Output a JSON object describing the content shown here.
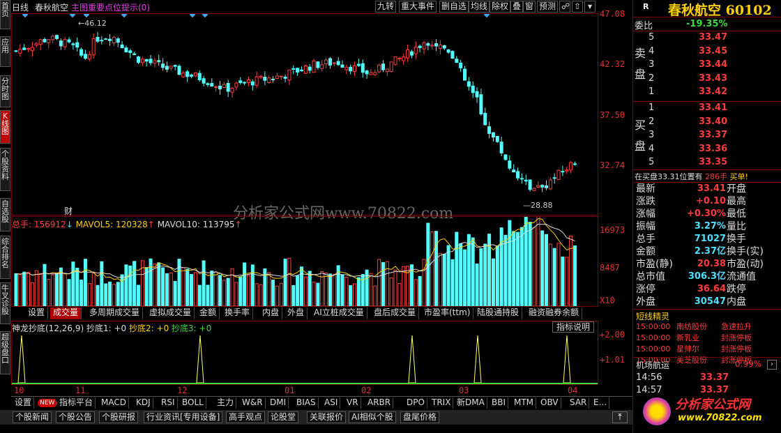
{
  "left_tabs": [
    "首页",
    "应用",
    "分时图",
    "K线图",
    "个股资料",
    "自选股",
    "综合排名",
    "牛叉诊股",
    "超级盘口"
  ],
  "top": {
    "period": "日线",
    "stock": "春秋航空",
    "hint": "主图重要点位提示(0)",
    "buttons": [
      "九转",
      "重大事件",
      "删自选",
      "均线",
      "除权",
      "叠",
      "窗",
      "预测"
    ]
  },
  "price_axis": [
    "47.08",
    "42.32",
    "37.50",
    "32.74"
  ],
  "high_label": "46.12",
  "low_label": "28.88",
  "cai_marker": "财",
  "watermark": "分析家公式网www.70822.com",
  "volume": {
    "label": "总手: 156912",
    "ma5": "MAVOL5: 120328",
    "ma10": "MAVOL10: 113795",
    "axis": [
      "16973",
      "8487"
    ],
    "unit": "X10"
  },
  "sub_tabs": [
    "设置",
    "成交量",
    "多周期成交量",
    "虚拟成交量",
    "金额",
    "换手率",
    "内盘",
    "外盘",
    "AI立桩成交量",
    "盘后成交量",
    "市盈率(ttm)",
    "陆股通持股",
    "融资融券余额"
  ],
  "indicator": {
    "title": "神龙抄底(12,26,9)",
    "v1": "抄底1: +0",
    "v2": "抄底2: +0",
    "v3": "抄底3: +0",
    "help": "指标说明",
    "axis": [
      "2.00",
      "1.01"
    ]
  },
  "months": [
    "10",
    "11",
    "12",
    "01",
    "02",
    "03",
    "04"
  ],
  "indicators_bar": [
    "设置",
    "NEW",
    "指标平台",
    "MACD",
    "KDJ",
    "RSI",
    "BOLL",
    "主力",
    "W&R",
    "DMI",
    "BIAS",
    "ASI",
    "VR",
    "ARBR",
    "DPO",
    "TRIX",
    "新DMA",
    "BBI",
    "MTM",
    "OBV",
    "SAR",
    "E..."
  ],
  "news_bar": [
    "个股新闻",
    "个股公告",
    "个股研报",
    "行业资讯[专用设备]",
    "高手观点",
    "论股堂",
    "关联报价",
    "AI相似个股",
    "盘尾价格"
  ],
  "right": {
    "r_icon": "R",
    "name": "春秋航空",
    "code": "60102",
    "webi_label": "委比",
    "webi": "-19.35%",
    "sell_label": "卖盘",
    "buy_label": "买盘",
    "sells": [
      [
        "5",
        "33.47"
      ],
      [
        "4",
        "33.45"
      ],
      [
        "3",
        "33.44"
      ],
      [
        "2",
        "33.43"
      ],
      [
        "1",
        "33.42"
      ]
    ],
    "buys": [
      [
        "1",
        "33.41"
      ],
      [
        "2",
        "33.40"
      ],
      [
        "3",
        "33.37"
      ],
      [
        "4",
        "33.36"
      ],
      [
        "5",
        "33.35"
      ]
    ],
    "buy_note": "在买盘33.31位置有",
    "buy_note_qty": "286手",
    "buy_note_end": "买单!",
    "stats": [
      [
        "最新",
        "33.41",
        "开盘",
        ""
      ],
      [
        "涨跌",
        "+0.10",
        "最高",
        ""
      ],
      [
        "涨幅",
        "+0.30%",
        "最低",
        ""
      ],
      [
        "振幅",
        "3.27%",
        "量比",
        ""
      ],
      [
        "总手",
        "71027",
        "换手",
        ""
      ],
      [
        "金额",
        "2.37亿",
        "换手(实)",
        ""
      ],
      [
        "市盈(静)",
        "20.38",
        "市盈(动)",
        ""
      ],
      [
        "总市值",
        "306.3亿",
        "流通值",
        ""
      ],
      [
        "涨停",
        "36.64",
        "跌停",
        ""
      ],
      [
        "外盘",
        "30547",
        "内盘",
        ""
      ]
    ],
    "elf_title": "短线精灵",
    "elf": [
      [
        "15:00:00",
        "南纺股份",
        "急速拉升"
      ],
      [
        "15:00:00",
        "新乳业",
        "封涨停板"
      ],
      [
        "15:00:00",
        "星帅尔",
        "封涨停板"
      ],
      [
        "15:00:00",
        "美芝股份",
        "封涨停板"
      ]
    ],
    "airport": "机场航运",
    "airport_pct": "0.99%",
    "ticks": [
      [
        "14:56",
        "33.37"
      ],
      [
        "14:57",
        "33.37"
      ]
    ],
    "logo": "分析家公式网",
    "logo_url": "www.70822.com"
  }
}
